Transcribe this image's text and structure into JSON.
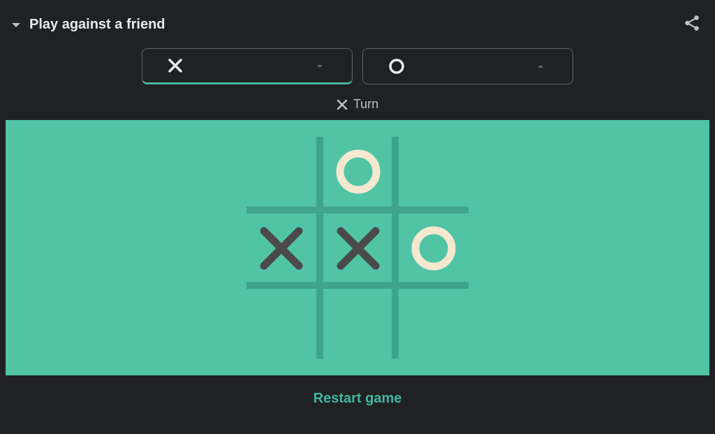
{
  "header": {
    "mode_label": "Play against a friend"
  },
  "score": {
    "x_value": "-",
    "o_value": "-",
    "active_player": "X"
  },
  "turn": {
    "player": "X",
    "label": "Turn"
  },
  "board": {
    "cells": [
      "",
      "O",
      "",
      "X",
      "X",
      "O",
      "",
      "",
      ""
    ]
  },
  "footer": {
    "restart_label": "Restart game"
  },
  "colors": {
    "board_bg": "#51c4a6",
    "grid": "#3fa48c",
    "x_mark": "#4a4a4a",
    "o_mark": "#f4e8cf",
    "accent": "#43b5a0"
  }
}
